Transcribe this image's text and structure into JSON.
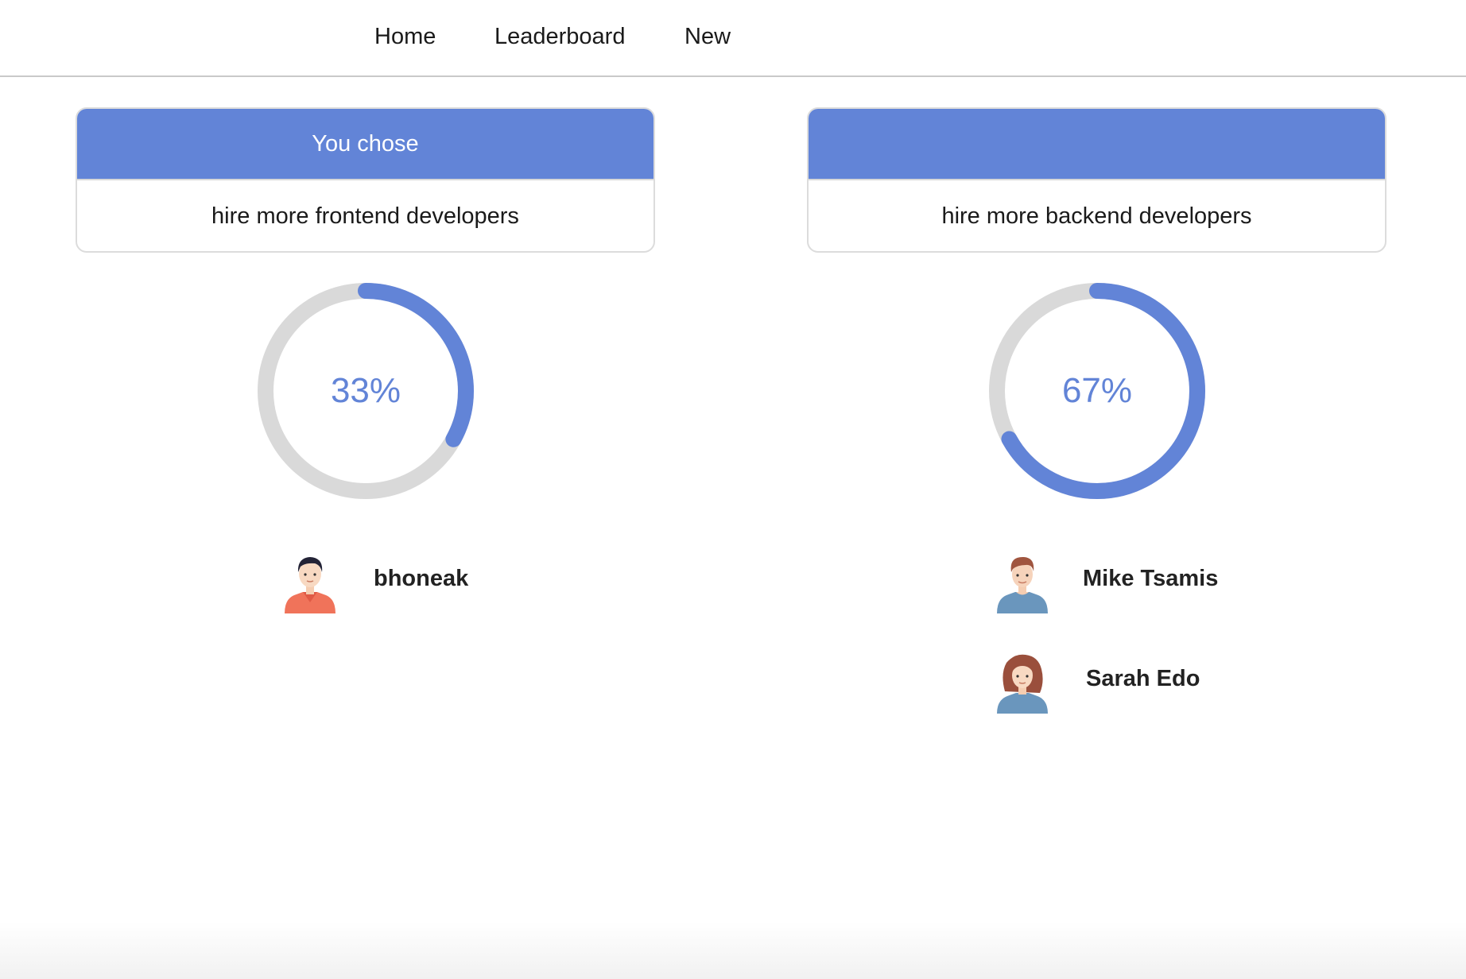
{
  "nav": {
    "items": [
      {
        "label": "Home"
      },
      {
        "label": "Leaderboard"
      },
      {
        "label": "New"
      }
    ]
  },
  "options": [
    {
      "header": "You chose",
      "text": "hire more frontend developers",
      "percent_label": "33%",
      "fraction": 0.33,
      "voters": [
        {
          "name": "bhoneak",
          "avatar": "avatar-man-dark-hair-red-shirt"
        }
      ]
    },
    {
      "header": "",
      "text": "hire more backend developers",
      "percent_label": "67%",
      "fraction": 0.67,
      "voters": [
        {
          "name": "Mike Tsamis",
          "avatar": "avatar-man-brown-hair-blue-shirt"
        },
        {
          "name": "Sarah Edo",
          "avatar": "avatar-woman-curly-hair-blue-shirt"
        }
      ]
    }
  ],
  "colors": {
    "accent": "#6284d7",
    "track": "#d9d9d9",
    "divider": "#c9c9c9"
  }
}
